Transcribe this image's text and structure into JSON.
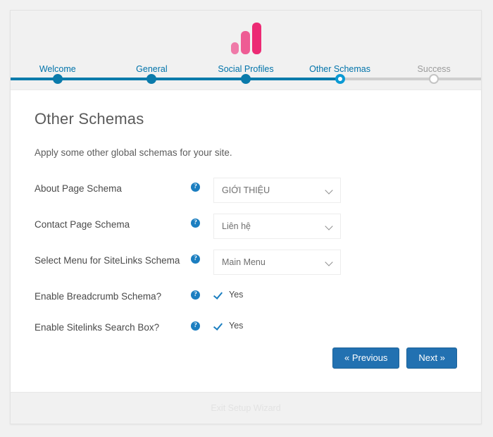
{
  "logo": {
    "name": "analytics-bars-logo",
    "bars": [
      {
        "color": "#ef7aa8"
      },
      {
        "color": "#ee5c94"
      },
      {
        "color": "#ec2a74"
      }
    ]
  },
  "stepper": {
    "steps": [
      {
        "label": "Welcome",
        "state": "done"
      },
      {
        "label": "General",
        "state": "done"
      },
      {
        "label": "Social Profiles",
        "state": "done"
      },
      {
        "label": "Other Schemas",
        "state": "current"
      },
      {
        "label": "Success",
        "state": "upcoming"
      }
    ],
    "active_color": "#0b7bab",
    "current_color": "#0b9ad4",
    "inactive_color": "#cfcfcf"
  },
  "main": {
    "title": "Other Schemas",
    "subtitle": "Apply some other global schemas for your site.",
    "rows": [
      {
        "label": "About Page Schema",
        "help_icon": "help-circle-icon",
        "type": "select",
        "value": "GIỚI THIỆU"
      },
      {
        "label": "Contact Page Schema",
        "help_icon": "help-circle-icon",
        "type": "select",
        "value": "Liên hệ"
      },
      {
        "label": "Select Menu for SiteLinks Schema",
        "help_icon": "help-circle-icon",
        "type": "select",
        "value": "Main Menu"
      },
      {
        "label": "Enable Breadcrumb Schema?",
        "help_icon": "help-circle-icon",
        "type": "checkbox",
        "value": "Yes",
        "checked": true
      },
      {
        "label": "Enable Sitelinks Search Box?",
        "help_icon": "help-circle-icon",
        "type": "checkbox",
        "value": "Yes",
        "checked": true
      }
    ]
  },
  "buttons": {
    "previous": "« Previous",
    "next": "Next »",
    "accent_color": "#2271b1"
  },
  "footer": {
    "exit_label": "Exit Setup Wizard"
  }
}
